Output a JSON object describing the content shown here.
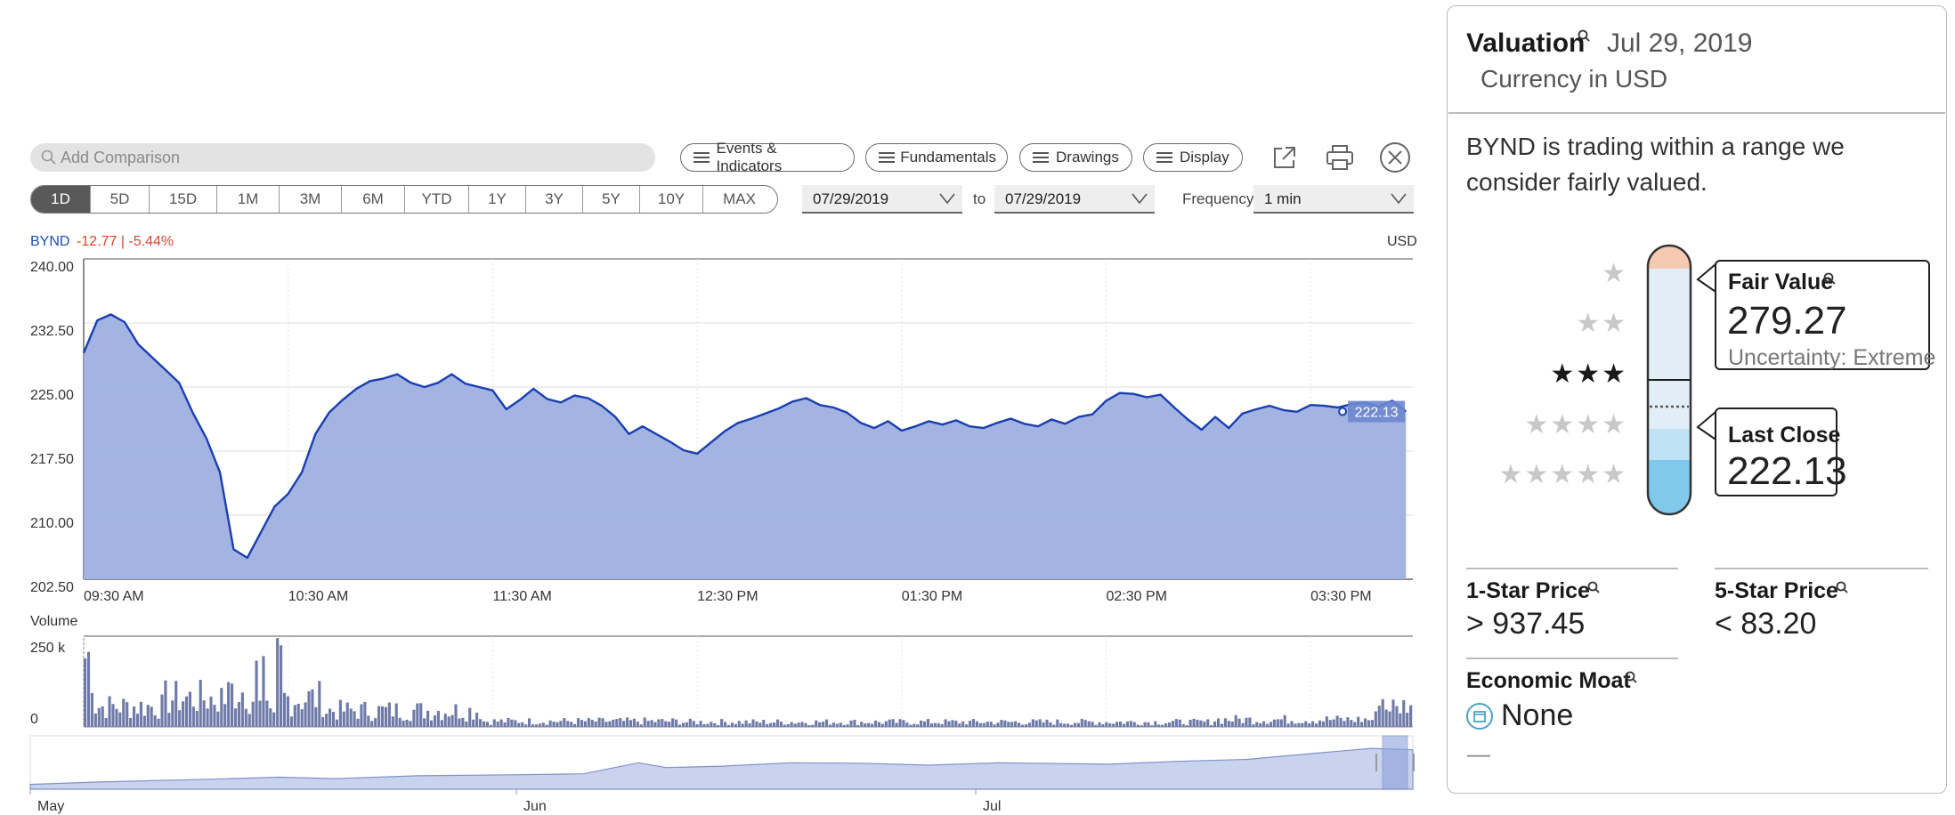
{
  "toolbar": {
    "search_placeholder": "Add Comparison",
    "events_label": "Events & Indicators",
    "fundamentals_label": "Fundamentals",
    "drawings_label": "Drawings",
    "display_label": "Display"
  },
  "ranges": [
    "1D",
    "5D",
    "15D",
    "1M",
    "3M",
    "6M",
    "YTD",
    "1Y",
    "3Y",
    "5Y",
    "10Y",
    "MAX"
  ],
  "active_range": "1D",
  "dates": {
    "from": "07/29/2019",
    "to_label": "to",
    "to": "07/29/2019"
  },
  "frequency": {
    "label": "Frequency",
    "value": "1 min"
  },
  "quote": {
    "symbol": "BYND",
    "change": "-12.77 | -5.44%",
    "currency": "USD",
    "last_tag": "222.13"
  },
  "chart_data": {
    "type": "area",
    "series": [
      {
        "name": "BYND",
        "color": "#1a3fb0",
        "fill": "#9eb0e0",
        "x": [
          "09:30",
          "09:34",
          "09:38",
          "09:42",
          "09:46",
          "09:50",
          "09:54",
          "09:58",
          "10:02",
          "10:06",
          "10:10",
          "10:14",
          "10:18",
          "10:22",
          "10:26",
          "10:30",
          "10:34",
          "10:38",
          "10:42",
          "10:46",
          "10:50",
          "10:54",
          "10:58",
          "11:02",
          "11:06",
          "11:10",
          "11:14",
          "11:18",
          "11:22",
          "11:26",
          "11:30",
          "11:34",
          "11:38",
          "11:42",
          "11:46",
          "11:50",
          "11:54",
          "11:58",
          "12:02",
          "12:06",
          "12:10",
          "12:14",
          "12:18",
          "12:22",
          "12:26",
          "12:30",
          "12:34",
          "12:38",
          "12:42",
          "12:46",
          "12:50",
          "12:54",
          "12:58",
          "13:02",
          "13:06",
          "13:10",
          "13:14",
          "13:18",
          "13:22",
          "13:26",
          "13:30",
          "13:34",
          "13:38",
          "13:42",
          "13:46",
          "13:50",
          "13:54",
          "13:58",
          "14:02",
          "14:06",
          "14:10",
          "14:14",
          "14:18",
          "14:22",
          "14:26",
          "14:30",
          "14:34",
          "14:38",
          "14:42",
          "14:46",
          "14:50",
          "14:54",
          "14:58",
          "15:02",
          "15:06",
          "15:10",
          "15:14",
          "15:18",
          "15:22",
          "15:26",
          "15:30",
          "15:34",
          "15:38",
          "15:42",
          "15:46",
          "15:50",
          "15:54",
          "15:58"
        ],
        "y": [
          229.0,
          232.8,
          233.5,
          232.6,
          230.0,
          228.5,
          227.0,
          225.5,
          222.0,
          219.0,
          215.0,
          206.0,
          205.0,
          208.0,
          211.0,
          212.5,
          215.0,
          219.5,
          222.0,
          223.5,
          224.8,
          225.7,
          226.0,
          226.5,
          225.5,
          225.0,
          225.5,
          226.5,
          225.4,
          225.0,
          224.6,
          222.4,
          223.5,
          224.8,
          223.6,
          223.2,
          224.0,
          223.7,
          222.8,
          221.5,
          219.5,
          220.4,
          219.5,
          218.6,
          217.6,
          217.2,
          218.5,
          219.8,
          220.8,
          221.3,
          221.9,
          222.5,
          223.3,
          223.7,
          222.9,
          222.6,
          222.0,
          220.8,
          220.2,
          221.0,
          219.9,
          220.4,
          221.0,
          220.6,
          221.1,
          220.4,
          220.2,
          220.8,
          221.3,
          220.7,
          220.4,
          221.2,
          220.7,
          221.5,
          221.8,
          223.4,
          224.3,
          224.2,
          223.8,
          224.1,
          222.6,
          221.2,
          220.0,
          221.5,
          220.2,
          221.9,
          222.4,
          222.8,
          222.3,
          222.1,
          222.9,
          222.8,
          222.6,
          223.0,
          223.2,
          222.7,
          223.4,
          222.13
        ]
      }
    ],
    "y_ticks": [
      "240.00",
      "232.50",
      "225.00",
      "217.50",
      "210.00",
      "202.50"
    ],
    "ylim": [
      202.5,
      240
    ],
    "x_ticks": [
      "09:30 AM",
      "10:30 AM",
      "11:30 AM",
      "12:30 PM",
      "01:30 PM",
      "02:30 PM",
      "03:30 PM"
    ],
    "grid": true,
    "volume": {
      "label": "Volume",
      "ticks": [
        "250 k",
        "0"
      ],
      "max": 250000
    },
    "navigator": {
      "x_ticks": [
        "May",
        "Jun",
        "Jul"
      ]
    }
  },
  "valuation": {
    "title": "Valuation",
    "date": "Jul 29, 2019",
    "currency": "Currency in USD",
    "description": "BYND is trading within a range we consider fairly valued.",
    "stars": [
      "★",
      "★★",
      "★★★",
      "★★★★",
      "★★★★★"
    ],
    "current_rating": 3,
    "fair_value": {
      "label": "Fair Value",
      "value": "279.27",
      "uncertainty": "Uncertainty: Extreme"
    },
    "last_close": {
      "label": "Last Close",
      "value": "222.13"
    },
    "one_star": {
      "label": "1-Star Price",
      "value": "> 937.45"
    },
    "five_star": {
      "label": "5-Star Price",
      "value": "< 83.20"
    },
    "moat": {
      "label": "Economic Moat",
      "value": "None",
      "trend": "—"
    },
    "colors": {
      "overvalued": "#f6c9b0",
      "fair": "#e2eef5",
      "undervalued_light": "#bfe3f4",
      "undervalued": "#80c9eb"
    }
  }
}
